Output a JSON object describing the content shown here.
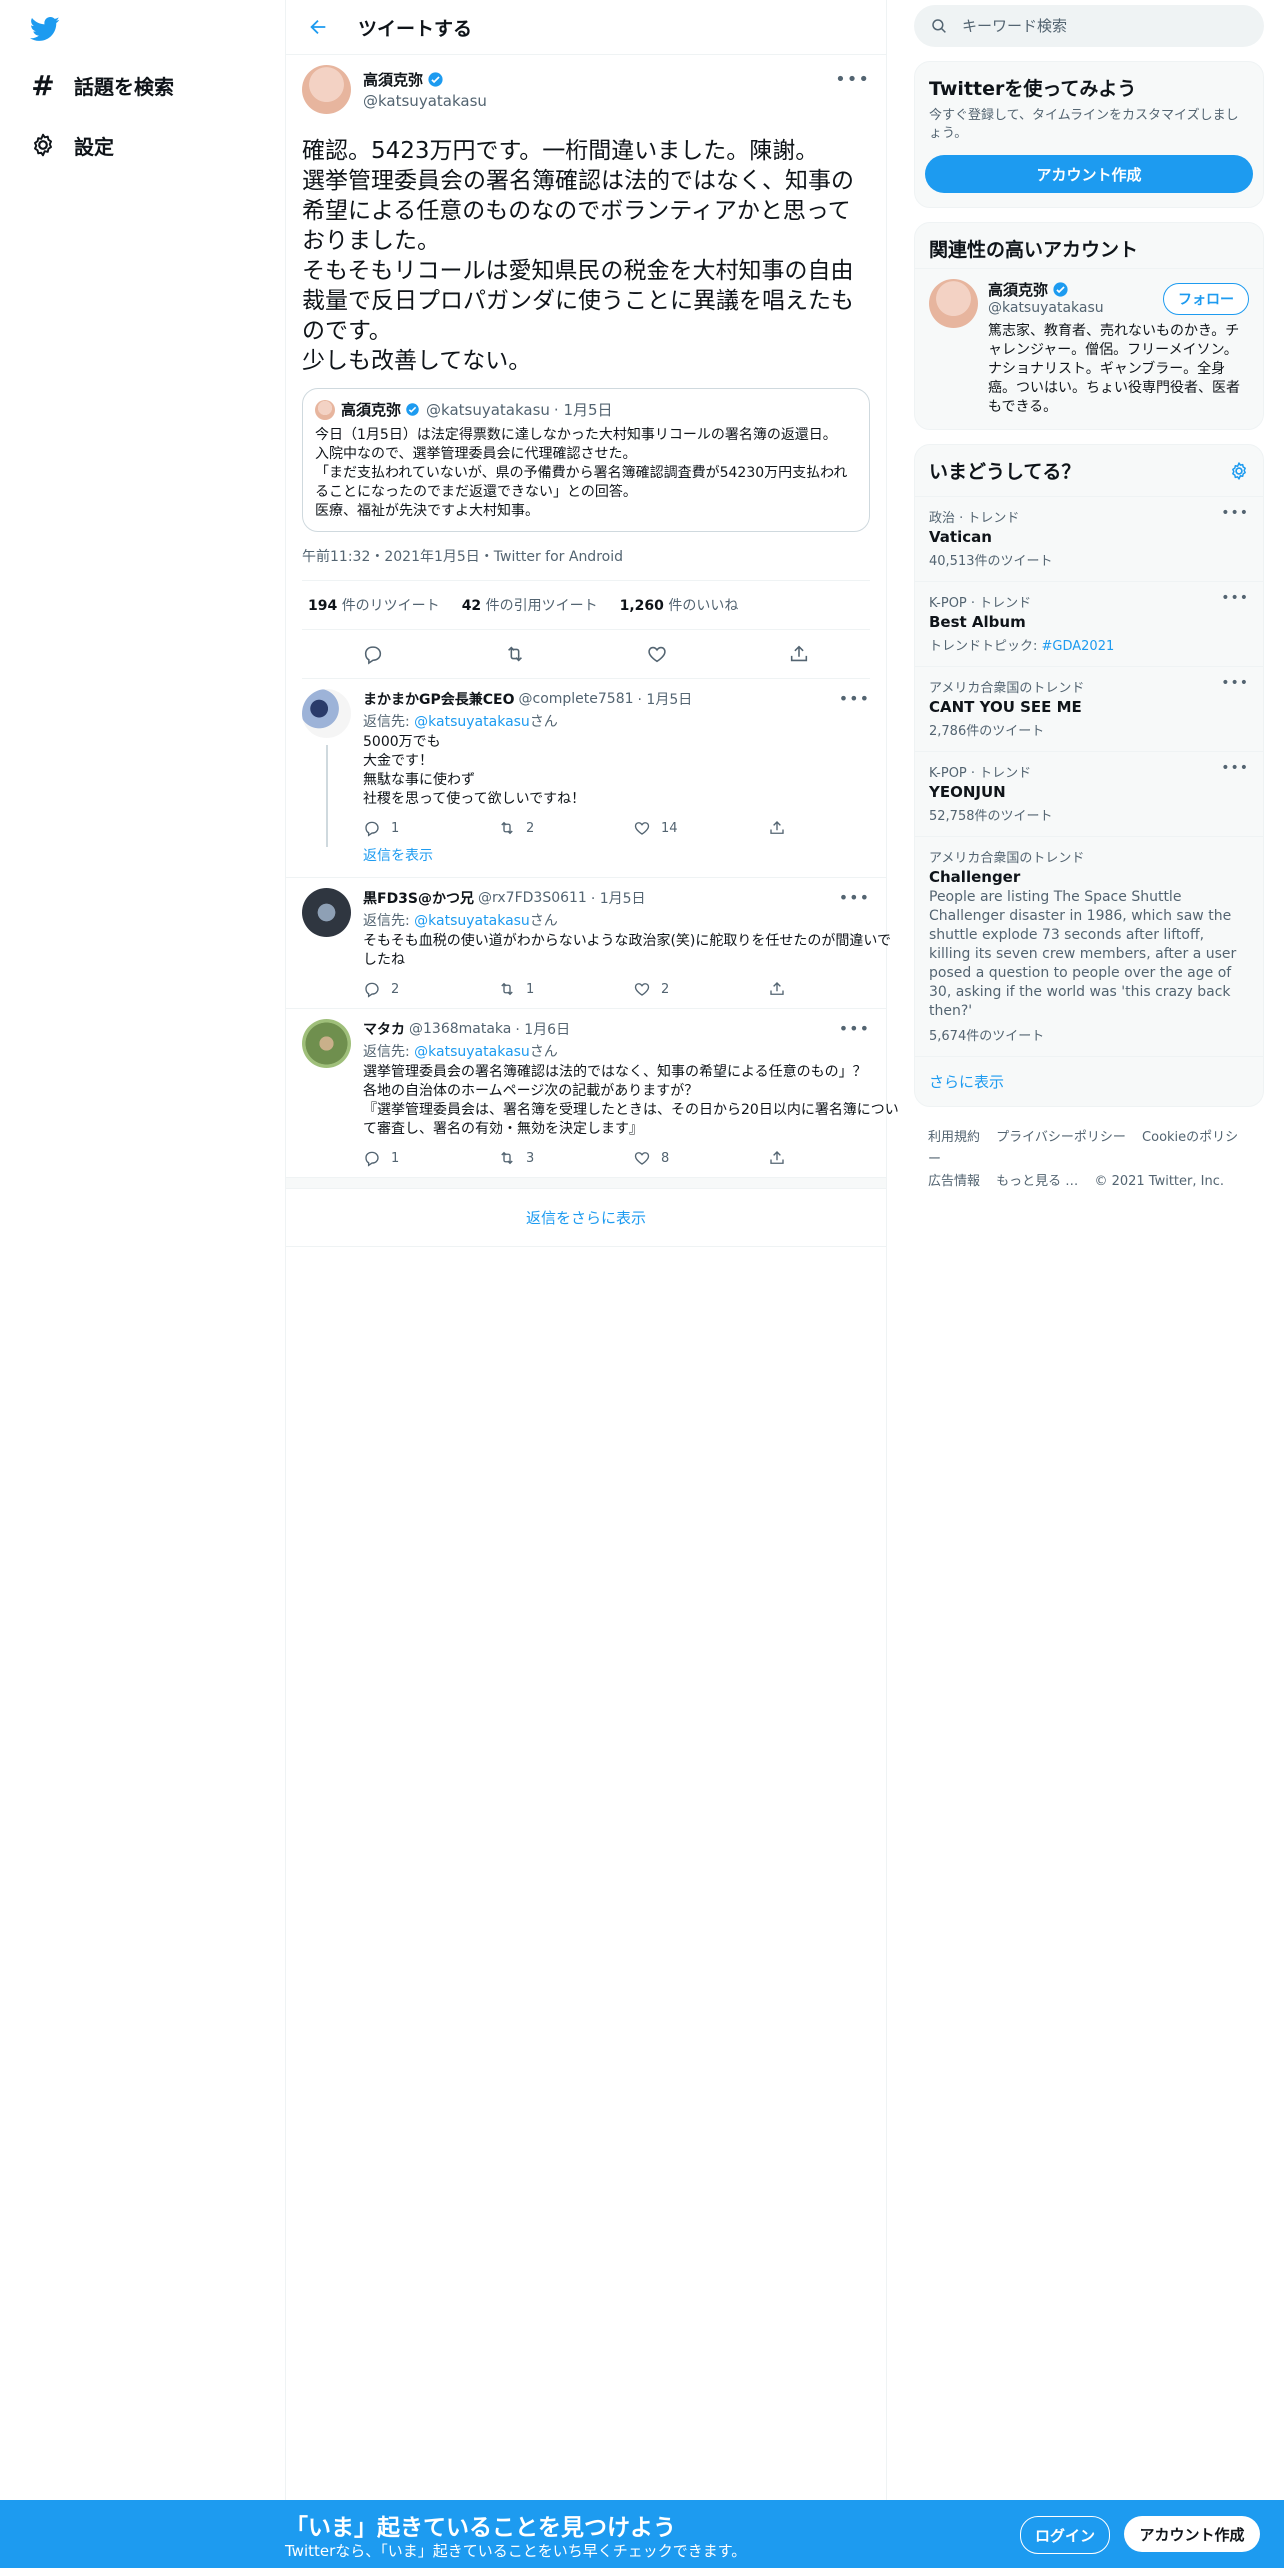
{
  "nav": {
    "explore_label": "話題を検索",
    "settings_label": "設定"
  },
  "header": {
    "title": "ツイートする"
  },
  "main_tweet": {
    "name": "高須克弥",
    "handle": "@katsuyatakasu",
    "text": "確認。5423万円です。一桁間違いました。陳謝。\n選挙管理委員会の署名簿確認は法的ではなく、知事の希望による任意のものなのでボランティアかと思っておりました。\nそもそもリコールは愛知県民の税金を大村知事の自由裁量で反日プロパガンダに使うことに異議を唱えたものです。\n少しも改善してない。",
    "quote": {
      "name": "高須克弥",
      "handle": "@katsuyatakasu",
      "date": "· 1月5日",
      "text": "今日（1月5日）は法定得票数に達しなかった大村知事リコールの署名簿の返還日。\n入院中なので、選挙管理委員会に代理確認させた。\n「まだ支払われていないが、県の予備費から署名簿確認調査費が54230万円支払われることになったのでまだ返還できない」との回答。\n医療、福祉が先決ですよ大村知事。"
    },
    "meta": "午前11:32・2021年1月5日・Twitter for Android",
    "retweets": "194",
    "retweets_label": "件のリツイート",
    "quotes": "42",
    "quotes_label": "件の引用ツイート",
    "likes": "1,260",
    "likes_label": "件のいいね"
  },
  "replies": [
    {
      "name": "まかまかGP会長兼CEO",
      "handle": "@complete7581",
      "date": "· 1月5日",
      "to_prefix": "返信先: ",
      "to_handle": "@katsuyatakasu",
      "to_suffix": "さん",
      "text": "5000万でも\n大金です！\n無駄な事に使わず\n社稷を思って使って欲しいですね！",
      "replies": "1",
      "retweets": "2",
      "likes": "14",
      "show_replies": "返信を表示"
    },
    {
      "name": "黒FD3S@かつ兄",
      "handle": "@rx7FD3S0611",
      "date": "· 1月5日",
      "to_prefix": "返信先: ",
      "to_handle": "@katsuyatakasu",
      "to_suffix": "さん",
      "text": "そもそも血税の使い道がわからないような政治家(笑)に舵取りを任せたのが間違いでしたね",
      "replies": "2",
      "retweets": "1",
      "likes": "2"
    },
    {
      "name": "マタカ",
      "handle": "@1368mataka",
      "date": "· 1月6日",
      "to_prefix": "返信先: ",
      "to_handle": "@katsuyatakasu",
      "to_suffix": "さん",
      "text": "選挙管理委員会の署名簿確認は法的ではなく、知事の希望による任意のもの」？\n各地の自治体のホームページ次の記載がありますが？\n『選挙管理委員会は、署名簿を受理したときは、その日から20日以内に署名簿について審査し、署名の有効・無効を決定します』",
      "replies": "1",
      "retweets": "3",
      "likes": "8"
    }
  ],
  "more_replies": "返信をさらに表示",
  "search": {
    "placeholder": "キーワード検索"
  },
  "signup_card": {
    "title": "Twitterを使ってみよう",
    "sub": "今すぐ登録して、タイムラインをカスタマイズしましょう。",
    "button": "アカウント作成"
  },
  "related": {
    "title": "関連性の高いアカウント",
    "name": "高須克弥",
    "handle": "@katsuyatakasu",
    "follow": "フォロー",
    "bio": "篤志家、教育者、売れないものかき。チャレンジャー。僧侶。フリーメイソン。ナショナリスト。ギャンブラー。全身癌。ついはい。ちょい役専門役者、医者もできる。"
  },
  "trends": {
    "title": "いまどうしてる？",
    "items": [
      {
        "context": "政治 · トレンド",
        "name": "Vatican",
        "count": "40,513件のツイート"
      },
      {
        "context": "K-POP · トレンド",
        "name": "Best Album",
        "count_prefix": "トレンドトピック: ",
        "count_link": "#GDA2021"
      },
      {
        "context": "アメリカ合衆国のトレンド",
        "name": "CANT YOU SEE ME",
        "count": "2,786件のツイート"
      },
      {
        "context": "K-POP · トレンド",
        "name": "YEONJUN",
        "count": "52,758件のツイート"
      },
      {
        "context": "アメリカ合衆国のトレンド",
        "name": "Challenger",
        "desc": "People are listing The Space Shuttle Challenger disaster in 1986, which saw the shuttle explode 73 seconds after liftoff, killing its seven crew members, after a user posed a question to people over the age of 30, asking if the world was 'this crazy back then?'",
        "count": "5,674件のツイート"
      }
    ],
    "show_more": "さらに表示"
  },
  "footer": {
    "terms": "利用規約",
    "privacy": "プライバシーポリシー",
    "cookie": "Cookieのポリシー",
    "ads": "広告情報",
    "more": "もっと見る …",
    "copyright": "© 2021 Twitter, Inc."
  },
  "bottom_bar": {
    "title": "「いま」起きていることを見つけよう",
    "sub": "Twitterなら、「いま」起きていることをいち早くチェックできます。",
    "login": "ログイン",
    "signup": "アカウント作成"
  },
  "colors": {
    "accent": "#1d9bf0",
    "text": "#0f1419",
    "muted": "#536471",
    "border": "#eff3f4"
  }
}
